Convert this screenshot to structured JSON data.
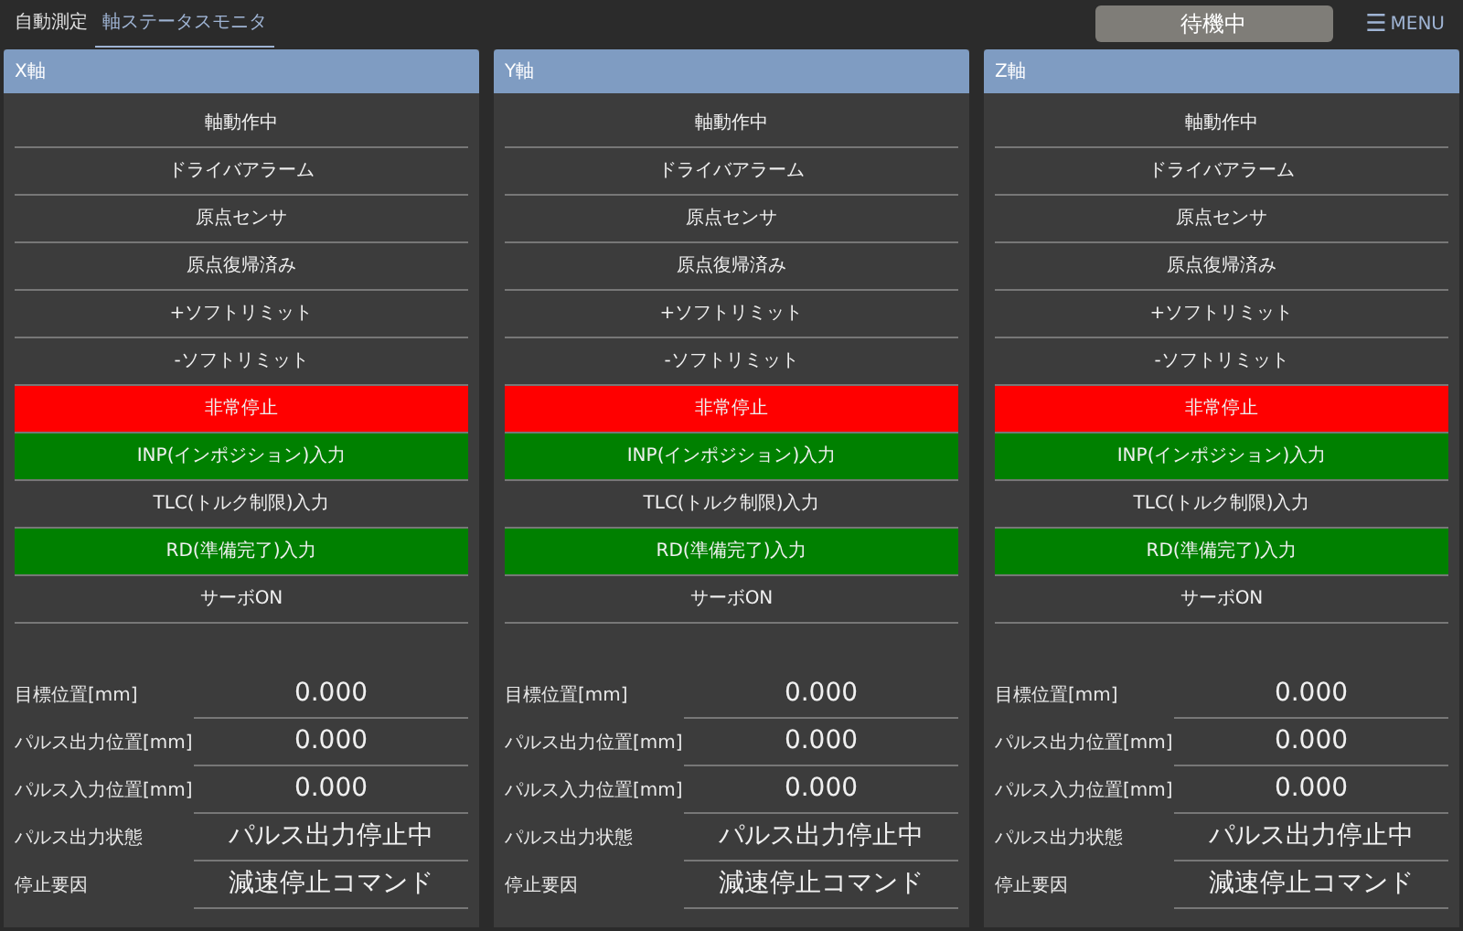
{
  "tabs": [
    {
      "label": "自動測定",
      "selected": false
    },
    {
      "label": "軸ステータスモニタ",
      "selected": true
    }
  ],
  "status": "待機中",
  "menu": {
    "icon": "☰",
    "label": "MENU"
  },
  "axes": [
    {
      "title": "X軸",
      "signals": [
        {
          "label": "軸動作中",
          "color": "#3c3c3c"
        },
        {
          "label": "ドライバアラーム",
          "color": "#3c3c3c"
        },
        {
          "label": "原点センサ",
          "color": "#3c3c3c"
        },
        {
          "label": "原点復帰済み",
          "color": "#3c3c3c"
        },
        {
          "label": "+ソフトリミット",
          "color": "#3c3c3c"
        },
        {
          "label": "-ソフトリミット",
          "color": "#3c3c3c"
        },
        {
          "label": "非常停止",
          "color": "#ff0000"
        },
        {
          "label": "INP(インポジション)入力",
          "color": "#008000"
        },
        {
          "label": "TLC(トルク制限)入力",
          "color": "#3c3c3c"
        },
        {
          "label": "RD(準備完了)入力",
          "color": "#008000"
        },
        {
          "label": "サーボON",
          "color": "#3c3c3c"
        }
      ],
      "values": [
        {
          "label": "目標位置[mm]",
          "value": "0.000"
        },
        {
          "label": "パルス出力位置[mm]",
          "value": "0.000"
        },
        {
          "label": "パルス入力位置[mm]",
          "value": "0.000"
        },
        {
          "label": "パルス出力状態",
          "value": "パルス出力停止中"
        },
        {
          "label": "停止要因",
          "value": "減速停止コマンド"
        }
      ]
    },
    {
      "title": "Y軸",
      "signals": [
        {
          "label": "軸動作中",
          "color": "#3c3c3c"
        },
        {
          "label": "ドライバアラーム",
          "color": "#3c3c3c"
        },
        {
          "label": "原点センサ",
          "color": "#3c3c3c"
        },
        {
          "label": "原点復帰済み",
          "color": "#3c3c3c"
        },
        {
          "label": "+ソフトリミット",
          "color": "#3c3c3c"
        },
        {
          "label": "-ソフトリミット",
          "color": "#3c3c3c"
        },
        {
          "label": "非常停止",
          "color": "#ff0000"
        },
        {
          "label": "INP(インポジション)入力",
          "color": "#008000"
        },
        {
          "label": "TLC(トルク制限)入力",
          "color": "#3c3c3c"
        },
        {
          "label": "RD(準備完了)入力",
          "color": "#008000"
        },
        {
          "label": "サーボON",
          "color": "#3c3c3c"
        }
      ],
      "values": [
        {
          "label": "目標位置[mm]",
          "value": "0.000"
        },
        {
          "label": "パルス出力位置[mm]",
          "value": "0.000"
        },
        {
          "label": "パルス入力位置[mm]",
          "value": "0.000"
        },
        {
          "label": "パルス出力状態",
          "value": "パルス出力停止中"
        },
        {
          "label": "停止要因",
          "value": "減速停止コマンド"
        }
      ]
    },
    {
      "title": "Z軸",
      "signals": [
        {
          "label": "軸動作中",
          "color": "#3c3c3c"
        },
        {
          "label": "ドライバアラーム",
          "color": "#3c3c3c"
        },
        {
          "label": "原点センサ",
          "color": "#3c3c3c"
        },
        {
          "label": "原点復帰済み",
          "color": "#3c3c3c"
        },
        {
          "label": "+ソフトリミット",
          "color": "#3c3c3c"
        },
        {
          "label": "-ソフトリミット",
          "color": "#3c3c3c"
        },
        {
          "label": "非常停止",
          "color": "#ff0000"
        },
        {
          "label": "INP(インポジション)入力",
          "color": "#008000"
        },
        {
          "label": "TLC(トルク制限)入力",
          "color": "#3c3c3c"
        },
        {
          "label": "RD(準備完了)入力",
          "color": "#008000"
        },
        {
          "label": "サーボON",
          "color": "#3c3c3c"
        }
      ],
      "values": [
        {
          "label": "目標位置[mm]",
          "value": "0.000"
        },
        {
          "label": "パルス出力位置[mm]",
          "value": "0.000"
        },
        {
          "label": "パルス入力位置[mm]",
          "value": "0.000"
        },
        {
          "label": "パルス出力状態",
          "value": "パルス出力停止中"
        },
        {
          "label": "停止要因",
          "value": "減速停止コマンド"
        }
      ]
    }
  ]
}
